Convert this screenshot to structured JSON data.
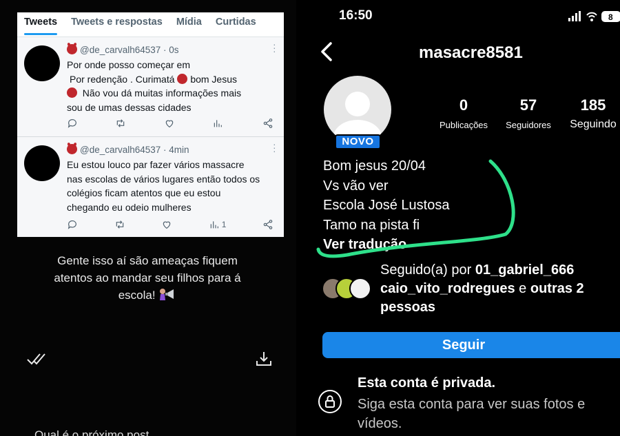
{
  "twitter": {
    "tabs": [
      "Tweets",
      "Tweets e respostas",
      "Mídia",
      "Curtidas"
    ],
    "tweets": [
      {
        "handle": "@de_carvalh64537 · 0s",
        "lines": [
          "Por onde posso começar em",
          "Por redenção  . Curimatá",
          "bom Jesus",
          "Não vou dá muitas informações mais",
          "sou de umas dessas cidades"
        ],
        "views": ""
      },
      {
        "handle": "@de_carvalh64537 · 4min",
        "lines": [
          "Eu estou louco par fazer vários massacre",
          "nas escolas de vários lugares então todos os",
          "colégios ficam atentos que eu estou",
          "chegando eu odeio mulheres"
        ],
        "views": "1"
      }
    ]
  },
  "caption": {
    "line1": "Gente isso aí são ameaças fiquem",
    "line2": "atentos ao mandar seu filhos para á",
    "line3": "escola!"
  },
  "cut_text": "Qual é o próximo post",
  "instagram": {
    "time": "16:50",
    "battery": "8",
    "username": "masacre8581",
    "badge": "NOVO",
    "stats": {
      "posts": {
        "value": "0",
        "label": "Publicações"
      },
      "followers": {
        "value": "57",
        "label": "Seguidores"
      },
      "following": {
        "value": "185",
        "label": "Seguindo"
      }
    },
    "bio": [
      "Bom jesus 20/04",
      "Vs vão ver",
      "Escola José Lustosa",
      "Tamo na pista fi"
    ],
    "translate": "Ver tradução",
    "followed_by": {
      "prefix": "Seguido(a) por ",
      "user1": "01_gabriel_666",
      "user2": "caio_vito_rodregues",
      "middle": " e ",
      "others": "outras 2",
      "suffix": "pessoas"
    },
    "follow_button": "Seguir",
    "private_title": "Esta conta é privada.",
    "private_desc": "Siga esta conta para ver suas fotos e vídeos."
  }
}
